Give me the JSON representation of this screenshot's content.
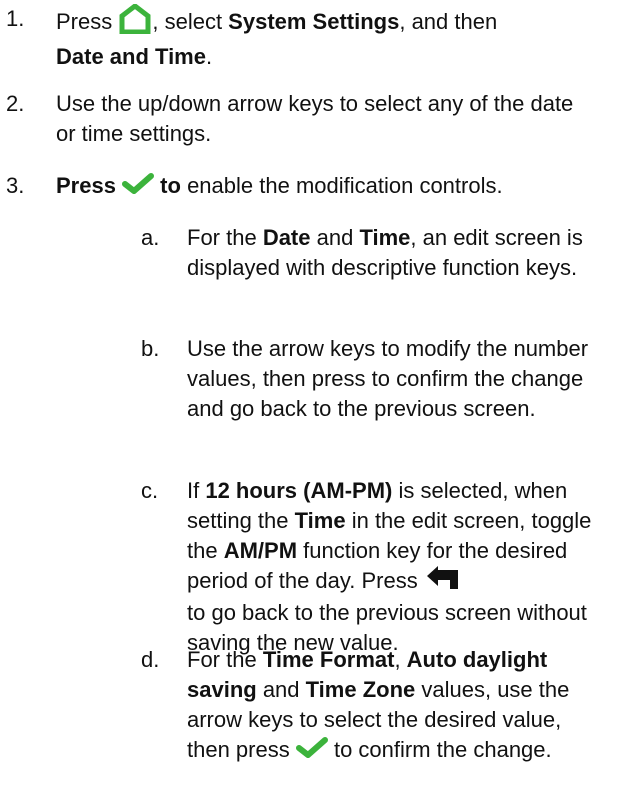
{
  "steps": [
    {
      "number": "1.",
      "a": "Press ",
      "icon": "home-icon",
      "b": ", select ",
      "bold1": "System Settings",
      "c": ", and then ",
      "bold2": "Date and Time",
      "d": "."
    },
    {
      "number": "2.",
      "text": "Use the up/down arrow keys to select any of the date or time settings."
    },
    {
      "number": "3.",
      "bold1": "Press ",
      "icon": "checkmark-icon",
      "bold2": " to",
      "text": " enable the modification controls."
    }
  ],
  "substeps": [
    {
      "letter": "a.",
      "t1": "For the ",
      "b1": "Date",
      "t2": " and ",
      "b2": "Time",
      "t3": ", an edit screen is displayed with descriptive function keys."
    },
    {
      "letter": "b.",
      "text": "Use the arrow keys to modify the number values, then press to confirm the change and go back to the previous screen."
    },
    {
      "letter": "c.",
      "t1": "If ",
      "b1": "12 hours (AM-PM)",
      "t2": " is selected, when setting the ",
      "b2": "Time",
      "t3": " in the edit screen, toggle the ",
      "b3": "AM/PM",
      "t4": " function key for the desired period of the day. Press",
      "icon": "back-arrow-icon",
      "t5": "to go back to the previous screen without saving the new value."
    },
    {
      "letter": "d.",
      "t1": "For the ",
      "b1": "Time Format",
      "t2": ", ",
      "b2": "Auto daylight saving",
      "t3": " and ",
      "b3": "Time Zone",
      "t4": " values, use the arrow keys to select the desired value, then press ",
      "icon": "checkmark-icon",
      "t5": " to confirm the change."
    }
  ],
  "colors": {
    "accent_green": "#3cb33c",
    "text": "#111111"
  }
}
